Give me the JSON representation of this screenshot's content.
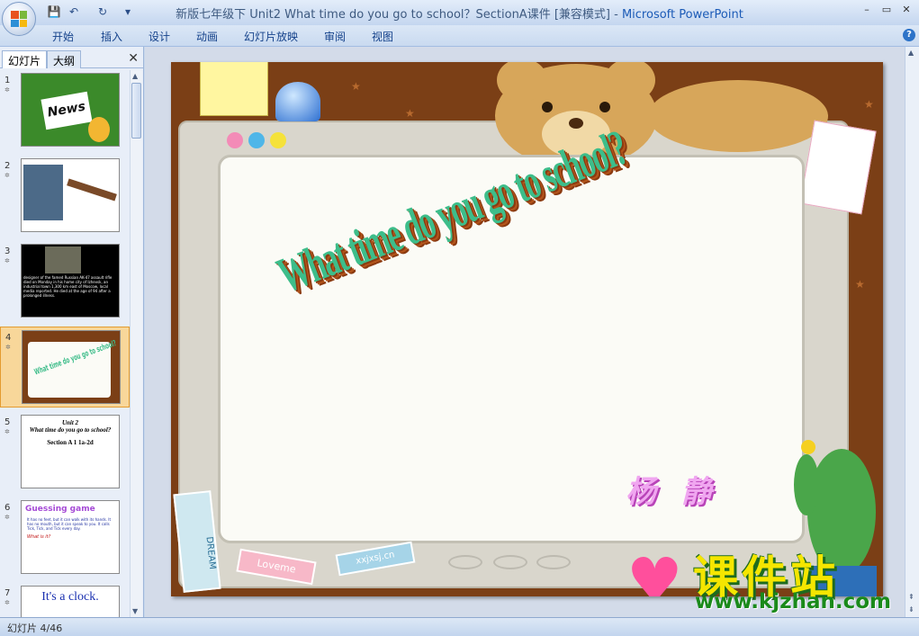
{
  "window": {
    "title_doc": "新版七年级下 Unit2 What time do you go to school？SectionA课件 [兼容模式]",
    "title_sep": " - ",
    "title_app": "Microsoft PowerPoint",
    "minimize": "–",
    "maximize": "▭",
    "close": "✕"
  },
  "quick_access": {
    "save": "💾",
    "undo": "↶",
    "redo": "↻",
    "more": "▾"
  },
  "ribbon": {
    "tabs": [
      "开始",
      "插入",
      "设计",
      "动画",
      "幻灯片放映",
      "审阅",
      "视图"
    ],
    "help": "?"
  },
  "panel": {
    "tab_slides": "幻灯片",
    "tab_outline": "大纲",
    "close": "✕",
    "thumbnails": [
      {
        "num": "1",
        "text": "News"
      },
      {
        "num": "2",
        "text": ""
      },
      {
        "num": "3",
        "text": "designer of the famed Russian AK-47 assault rifle died on Monday in his home city of Izhevsk, an industrial town 1,300 km east of Moscow, local media reported. He died at the age of 94 after a prolonged illness."
      },
      {
        "num": "4",
        "text": "What time do you go to school?"
      },
      {
        "num": "5",
        "line1": "Unit 2",
        "line2": "What time do you go to school?",
        "line3": "Section A 1 1a-2d"
      },
      {
        "num": "6",
        "line1": "Guessing game",
        "line2": "It has no feet, but it can walk with its hands. It has no mouth, but it can speak to you. It calls Tick, Tick, and Tick every day.",
        "line3": "What is it?"
      },
      {
        "num": "7",
        "text": "It's a clock."
      }
    ]
  },
  "slide": {
    "headline": "What time do you go to school?",
    "author": "杨 静",
    "sticker_dream": "DREAM",
    "sticker_love": "Loveme",
    "sticker_url": "xxjxsj.cn"
  },
  "watermark": {
    "main": "课件站",
    "url": "www.kjzhan.com"
  },
  "status": {
    "text": "幻灯片 4/46"
  },
  "colors": {
    "slide_bg": "#7b3f16",
    "headline": "#3dbd8a",
    "author": "#f0a6f0",
    "watermark_main": "#f5e600"
  }
}
